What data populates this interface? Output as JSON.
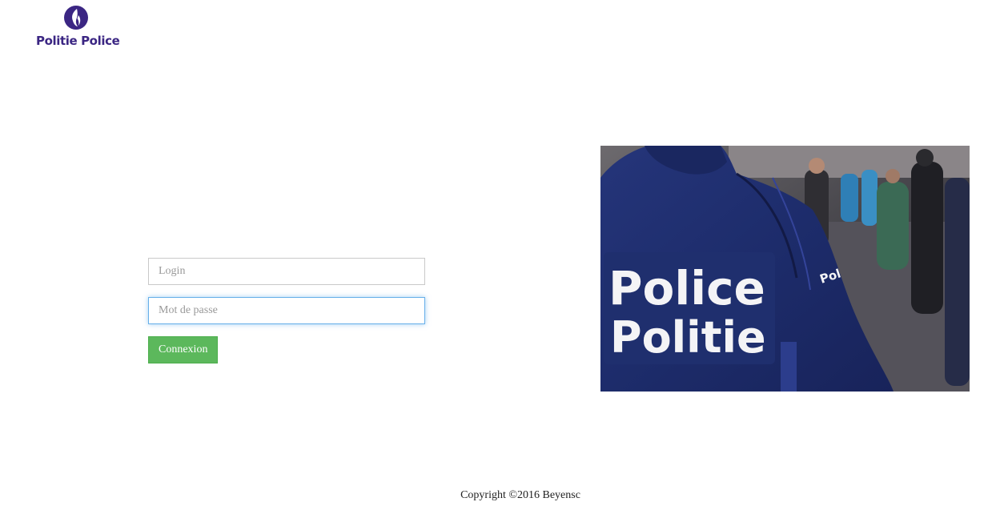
{
  "brand": {
    "logo_text": "Politie Police",
    "color": "#3b2683",
    "icon": "flame-icon"
  },
  "login_form": {
    "login_placeholder": "Login",
    "password_placeholder": "Mot de passe",
    "submit_label": "Connexion",
    "accent_color": "#5cb85c"
  },
  "hero_image": {
    "subject": "police-officer-photo",
    "patch_line1": "Police",
    "patch_line2": "Politie",
    "sleeve_text": "Pol"
  },
  "footer": {
    "copyright": "Copyright ©2016 Beyensc"
  }
}
